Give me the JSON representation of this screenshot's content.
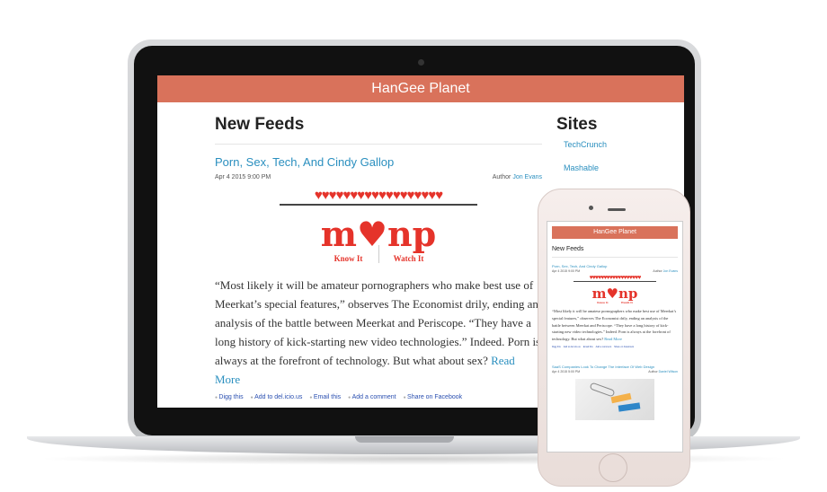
{
  "site": {
    "title": "HanGee Planet",
    "feeds_heading": "New Feeds",
    "sites_heading": "Sites",
    "sites": [
      "TechCrunch",
      "Mashable"
    ]
  },
  "post": {
    "title": "Porn, Sex, Tech, And Cindy Gallop",
    "date": "Apr 4 2015 9:00 PM",
    "author_label": "Author",
    "author": "Jon Evans",
    "logo_text": "m♥np",
    "hearts": "♥♥♥♥♥♥♥♥♥♥♥♥♥♥♥♥♥♥",
    "know_it": "Know It",
    "watch_it": "Watch It",
    "body": "“Most likely it will be amateur pornographers who make best use of Meerkat’s special features,” observes The Economist drily, ending an analysis of the battle between Meerkat and Periscope. “They have a long history of kick-starting new video technologies.” Indeed. Porn is always at the forefront of technology. But what about sex?",
    "read_more": "Read More",
    "share": [
      "Digg this",
      "Add to del.icio.us",
      "Email this",
      "Add a comment",
      "Share on Facebook"
    ]
  },
  "phone_post2": {
    "title": "SaaS Companies Look To Change The Interface Of Web Design",
    "date": "Apr 4 2015 5:00 PM",
    "author_label": "Author",
    "author": "Daniel Wilson"
  },
  "colors": {
    "header": "#d9725b",
    "link": "#2a8fbf",
    "accent": "#e5332a"
  }
}
